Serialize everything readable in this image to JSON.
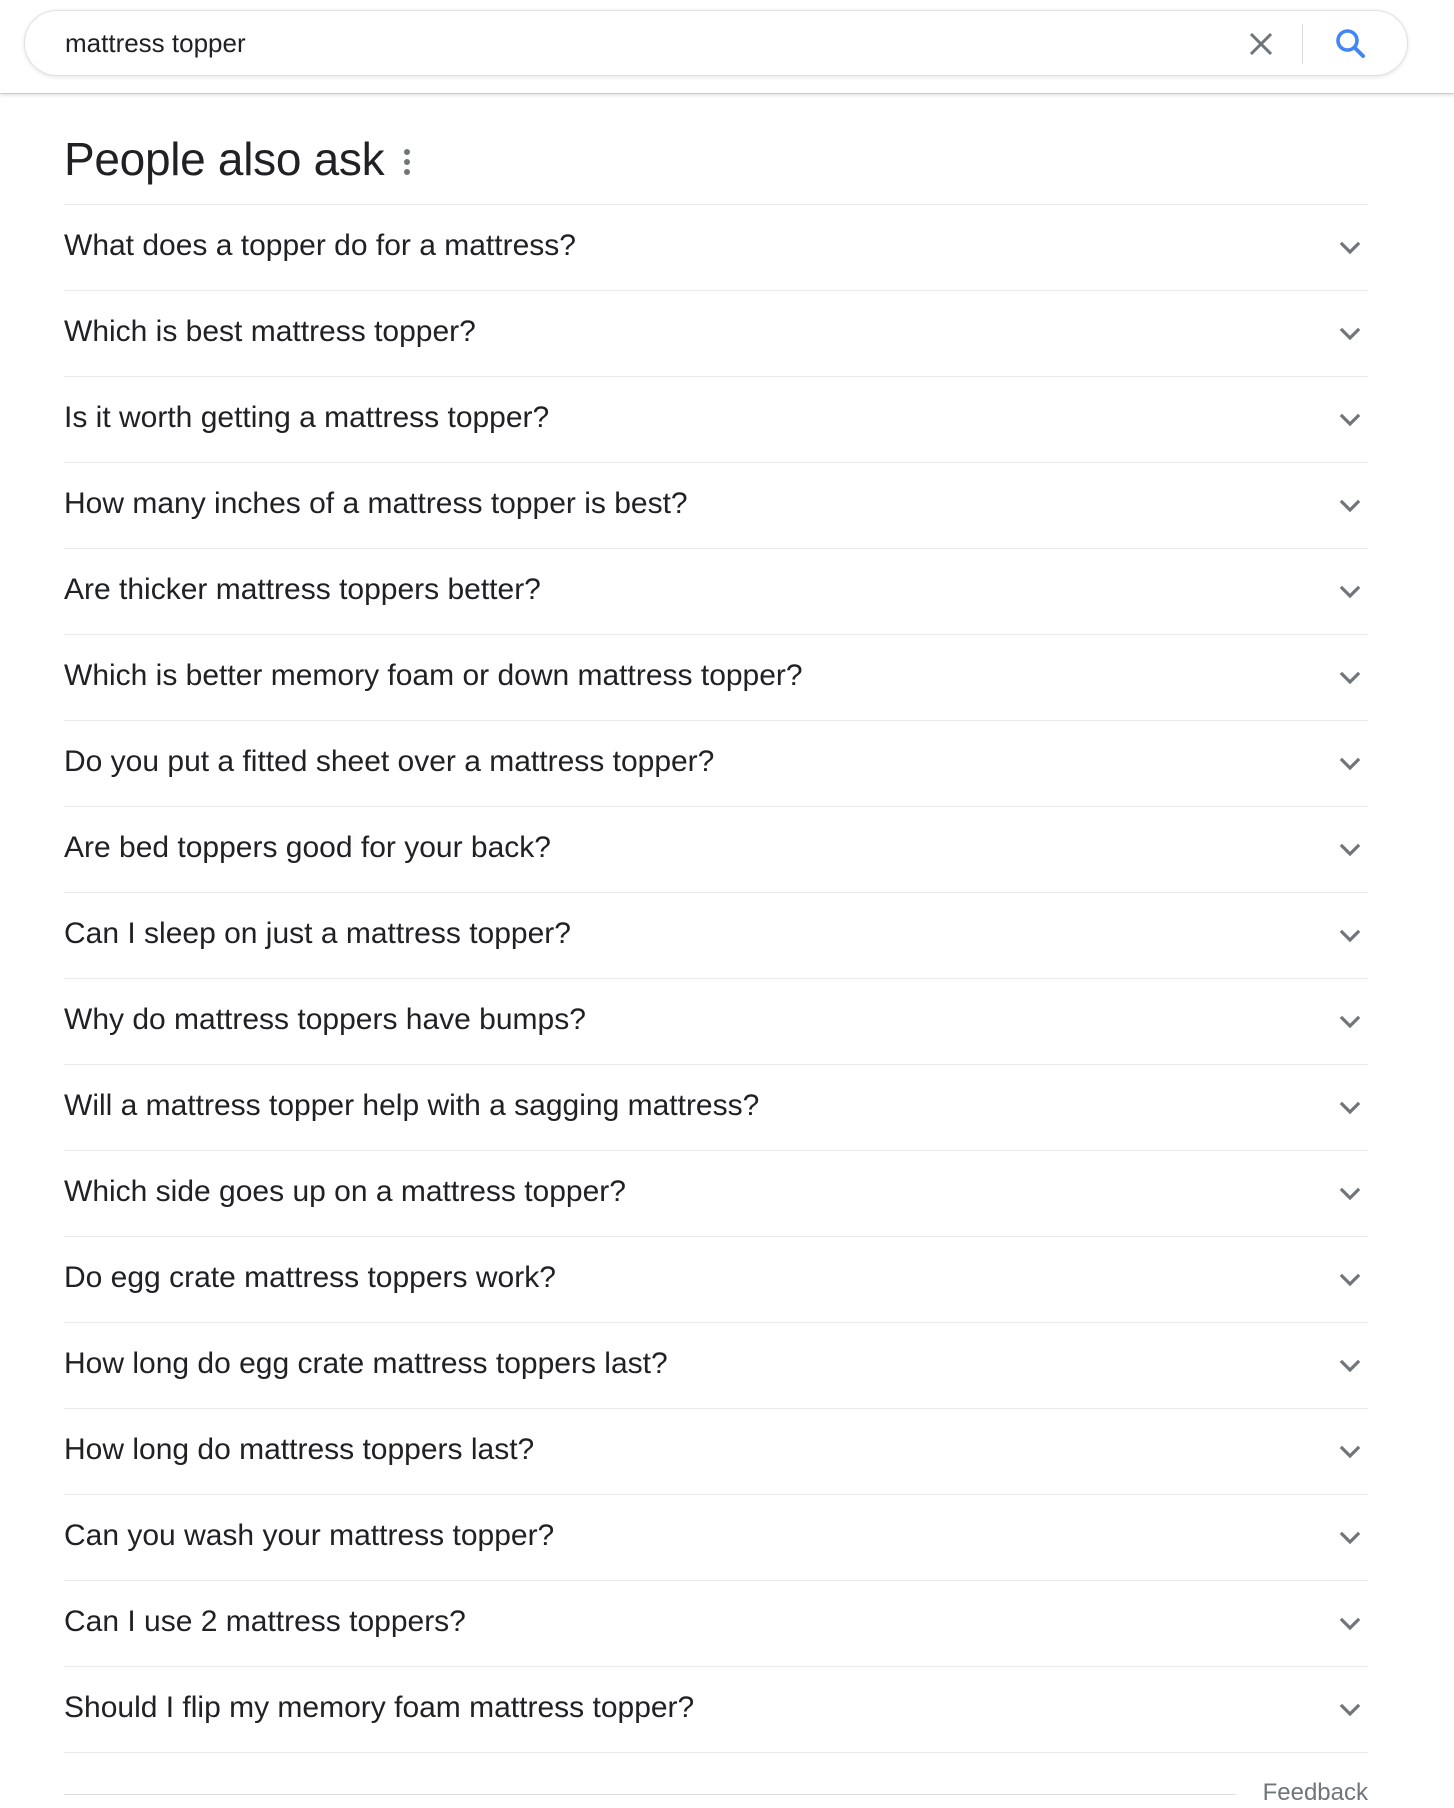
{
  "search": {
    "value": "mattress topper",
    "clear_icon": "close-icon",
    "search_icon": "search-icon"
  },
  "paa": {
    "title": "People also ask",
    "menu_icon": "more-vert-icon",
    "questions": [
      "What does a topper do for a mattress?",
      "Which is best mattress topper?",
      "Is it worth getting a mattress topper?",
      "How many inches of a mattress topper is best?",
      "Are thicker mattress toppers better?",
      "Which is better memory foam or down mattress topper?",
      "Do you put a fitted sheet over a mattress topper?",
      "Are bed toppers good for your back?",
      "Can I sleep on just a mattress topper?",
      "Why do mattress toppers have bumps?",
      "Will a mattress topper help with a sagging mattress?",
      "Which side goes up on a mattress topper?",
      "Do egg crate mattress toppers work?",
      "How long do egg crate mattress toppers last?",
      "How long do mattress toppers last?",
      "Can you wash your mattress topper?",
      "Can I use 2 mattress toppers?",
      "Should I flip my memory foam mattress topper?"
    ],
    "expand_icon": "chevron-down-icon",
    "feedback_label": "Feedback"
  },
  "colors": {
    "text": "#202124",
    "search_blue": "#4285f4",
    "icon_gray": "#70757a",
    "divider": "#ebebeb"
  }
}
